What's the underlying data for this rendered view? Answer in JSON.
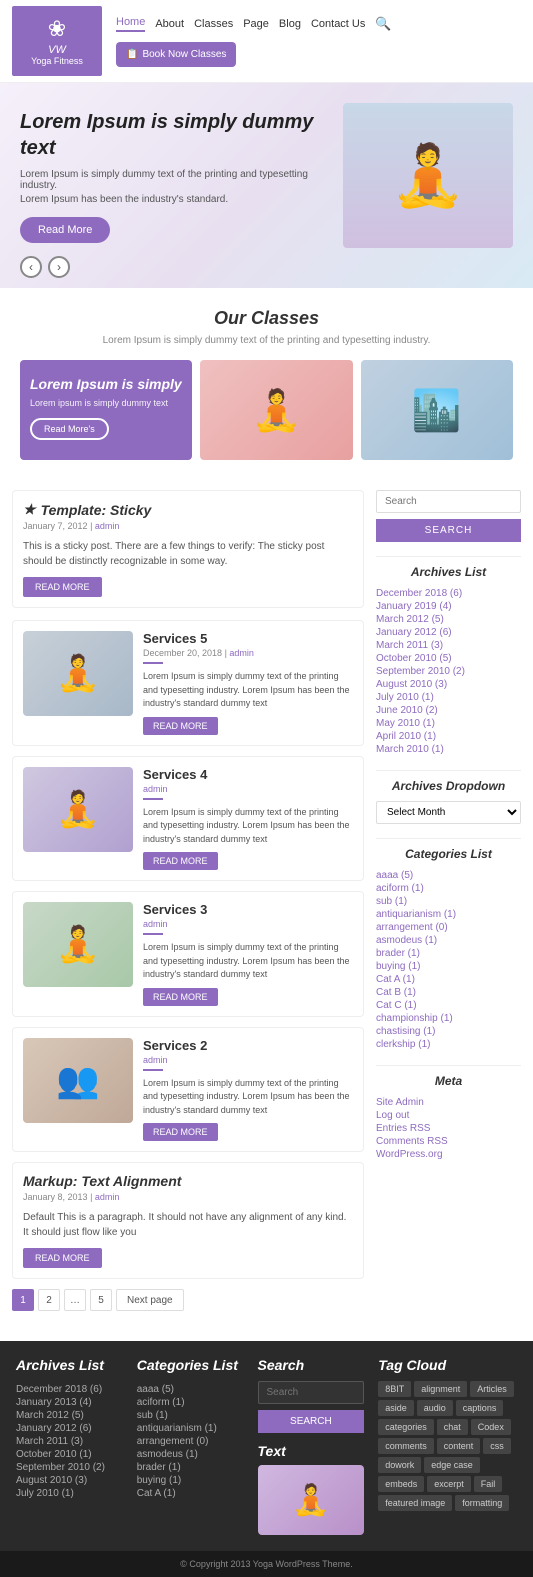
{
  "site": {
    "logo_icon": "❀",
    "logo_vw": "VW",
    "logo_name": "Yoga Fitness"
  },
  "nav": {
    "items": [
      {
        "label": "Home",
        "active": true,
        "has_arrow": false
      },
      {
        "label": "About",
        "active": false,
        "has_arrow": false
      },
      {
        "label": "Classes",
        "active": false,
        "has_arrow": true
      },
      {
        "label": "Page",
        "active": false,
        "has_arrow": true
      },
      {
        "label": "Blog",
        "active": false,
        "has_arrow": false
      },
      {
        "label": "Contact Us",
        "active": false,
        "has_arrow": false
      }
    ],
    "book_btn": "Book Now Classes"
  },
  "hero": {
    "title": "Lorem Ipsum is simply dummy text",
    "desc_line1": "Lorem Ipsum is simply dummy text of the printing and typesetting industry.",
    "desc_line2": "Lorem Ipsum has been the industry's standard.",
    "read_more": "Read More",
    "prev": "‹",
    "next": "›"
  },
  "our_classes": {
    "title": "Our Classes",
    "subtitle": "Lorem Ipsum is simply dummy text of the printing and typesetting industry.",
    "cards": [
      {
        "type": "featured",
        "title": "Lorem Ipsum is simply",
        "desc": "Lorem ipsum is simply dummy text",
        "btn": "Read More's"
      },
      {
        "type": "image",
        "style": "yoga"
      },
      {
        "type": "image",
        "style": "city"
      }
    ]
  },
  "sticky_post": {
    "title": "Template: Sticky",
    "date": "January 7, 2012",
    "author": "admin",
    "excerpt": "This is a sticky post. There are a few things to verify: The sticky post should be distinctly recognizable in some way.",
    "read_more": "READ MORE"
  },
  "service_posts": [
    {
      "title": "Services 5",
      "date": "December 20, 2018",
      "author": "admin",
      "excerpt": "Lorem Ipsum is simply dummy text of the printing and typesetting industry. Lorem Ipsum has been the industry's standard dummy text",
      "read_more": "READ MORE",
      "img_style": "1"
    },
    {
      "title": "Services 4",
      "date": "",
      "author": "admin",
      "excerpt": "Lorem Ipsum is simply dummy text of the printing and typesetting industry. Lorem Ipsum has been the industry's standard dummy text",
      "read_more": "READ MORE",
      "img_style": "2"
    },
    {
      "title": "Services 3",
      "date": "",
      "author": "admin",
      "excerpt": "Lorem Ipsum is simply dummy text of the printing and typesetting industry. Lorem Ipsum has been the industry's standard dummy text",
      "read_more": "READ MORE",
      "img_style": "3"
    },
    {
      "title": "Services 2",
      "date": "",
      "author": "admin",
      "excerpt": "Lorem Ipsum is simply dummy text of the printing and typesetting industry. Lorem Ipsum has been the industry's standard dummy text",
      "read_more": "READ MORE",
      "img_style": "4"
    }
  ],
  "markup_post": {
    "title": "Markup: Text Alignment",
    "date": "January 8, 2013",
    "author": "admin",
    "excerpt": "Default This is a paragraph. It should not have any alignment of any kind. It should just flow like you",
    "read_more": "READ MORE"
  },
  "pagination": {
    "pages": [
      "1",
      "2",
      "…",
      "5"
    ],
    "next_label": "Next page"
  },
  "sidebar": {
    "search": {
      "placeholder": "Search",
      "btn_label": "SEARCH"
    },
    "archives_title": "Archives List",
    "archives": [
      "December 2018 (6)",
      "January 2019 (4)",
      "March 2012 (5)",
      "January 2012 (6)",
      "March 2011 (3)",
      "October 2010 (5)",
      "September 2010 (2)",
      "August 2010 (3)",
      "July 2010 (1)",
      "June 2010 (2)",
      "May 2010 (1)",
      "April 2010 (1)",
      "March 2010 (1)"
    ],
    "archives_dropdown_title": "Archives Dropdown",
    "select_month": "Select Month",
    "categories_title": "Categories List",
    "categories": [
      "aaaa (5)",
      "aciform (1)",
      "sub (1)",
      "antiquarianism (1)",
      "arrangement (0)",
      "asmodeus (1)",
      "brader (1)",
      "buying (1)",
      "Cat A (1)",
      "Cat B (1)",
      "Cat C (1)",
      "championship (1)",
      "chastising (1)",
      "clerkship (1)"
    ],
    "meta_title": "Meta",
    "meta_items": [
      "Site Admin",
      "Log out",
      "Entries RSS",
      "Comments RSS",
      "WordPress.org"
    ]
  },
  "footer_widgets": {
    "archives_title": "Archives List",
    "archives": [
      "December 2018 (6)",
      "January 2013 (4)",
      "March 2012 (5)",
      "January 2012 (6)",
      "March 2011 (3)",
      "October 2010 (1)",
      "September 2010 (2)",
      "August 2010 (3)",
      "July 2010 (1)"
    ],
    "categories_title": "Categories List",
    "categories": [
      "aaaa (5)",
      "aciform (1)",
      "sub (1)",
      "antiquarianism (1)",
      "arrangement (0)",
      "asmodeus (1)",
      "brader (1)",
      "buying (1)",
      "Cat A (1)"
    ],
    "search_title": "Search",
    "search_placeholder": "Search",
    "search_btn": "SEARCH",
    "text_title": "Text",
    "tag_cloud_title": "Tag Cloud",
    "tags": [
      "8BIT",
      "alignment",
      "Articles",
      "aside",
      "audio",
      "captions",
      "categories",
      "chat",
      "Codex",
      "comments",
      "content",
      "css",
      "dowork",
      "edge case",
      "embeds",
      "excerpt",
      "Fail",
      "featured image",
      "formatting"
    ]
  },
  "footer_bottom": {
    "text": "© Copyright 2013 Yoga WordPress Theme."
  }
}
